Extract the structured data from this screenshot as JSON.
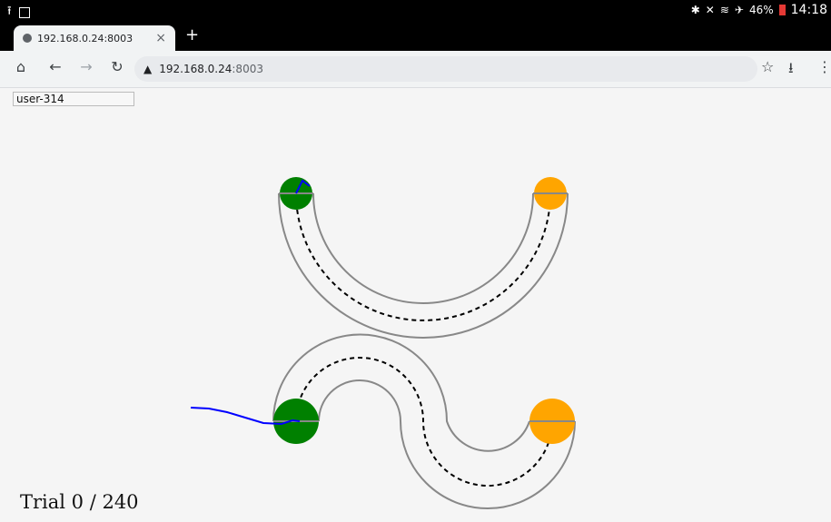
{
  "status_bar": {
    "time": "14:18",
    "battery": "46%",
    "icons": [
      "upload-icon",
      "image-icon",
      "bluetooth-icon",
      "mute-icon",
      "wifi-icon",
      "airplane-icon",
      "battery-icon"
    ]
  },
  "browser": {
    "tab_title": "192.168.0.24:8003",
    "url_host": "192.168.0.24",
    "url_port": ":8003",
    "new_tab_label": "+",
    "close_label": "×"
  },
  "page": {
    "user_id": "user-314",
    "trial_text": "Trial 0 / 240"
  },
  "colors": {
    "start_marker": "#008000",
    "end_marker": "#ffa500",
    "track_border": "#888888",
    "guide_line": "#000000",
    "cursor_trace": "#0000ff"
  }
}
